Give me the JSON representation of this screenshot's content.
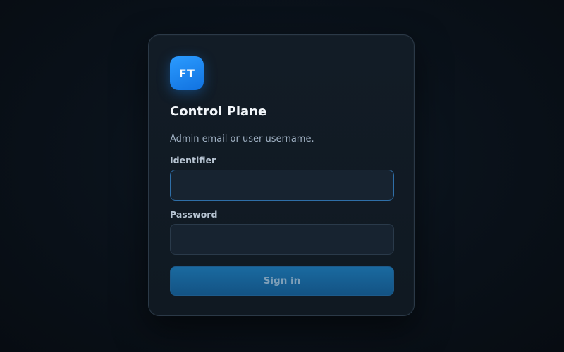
{
  "logo": {
    "text": "FT"
  },
  "login": {
    "title": "Control Plane",
    "subtitle": "Admin email or user username.",
    "identifier_label": "Identifier",
    "identifier_value": "",
    "password_label": "Password",
    "password_value": "",
    "submit_label": "Sign in"
  },
  "colors": {
    "accent": "#1e8cff",
    "background": "#0a121b",
    "card": "#121c26"
  }
}
